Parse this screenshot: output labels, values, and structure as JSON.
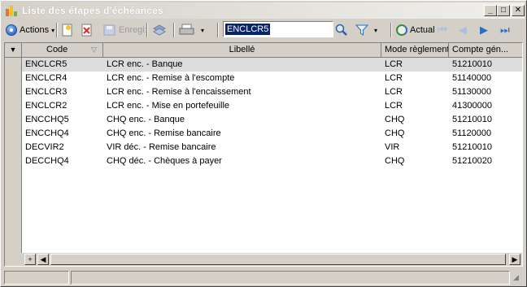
{
  "window": {
    "title": "Liste des étapes d'échéances",
    "min_label": "_",
    "max_label": "□",
    "close_label": "✕"
  },
  "toolbar": {
    "actions_label": "Actions",
    "save_label": "Enregi:",
    "search_value": "ENCLCR5",
    "refresh_label": "Actual"
  },
  "grid": {
    "columns": [
      "Code",
      "Libellé",
      "Mode règlement",
      "Compte gén..."
    ],
    "rows": [
      {
        "code": "ENCLCR5",
        "libelle": "LCR enc. - Banque",
        "mode": "LCR",
        "compte": "51210010"
      },
      {
        "code": "ENCLCR4",
        "libelle": "LCR enc. - Remise à l'escompte",
        "mode": "LCR",
        "compte": "51140000"
      },
      {
        "code": "ENCLCR3",
        "libelle": "LCR enc. - Remise à l'encaissement",
        "mode": "LCR",
        "compte": "51130000"
      },
      {
        "code": "ENCLCR2",
        "libelle": "LCR enc. - Mise en portefeuille",
        "mode": "LCR",
        "compte": "41300000"
      },
      {
        "code": "ENCCHQ5",
        "libelle": "CHQ enc. - Banque",
        "mode": "CHQ",
        "compte": "51210010"
      },
      {
        "code": "ENCCHQ4",
        "libelle": "CHQ enc. - Remise bancaire",
        "mode": "CHQ",
        "compte": "51120000"
      },
      {
        "code": "DECVIR2",
        "libelle": "VIR déc. - Remise bancaire",
        "mode": "VIR",
        "compte": "51210010"
      },
      {
        "code": "DECCHQ4",
        "libelle": "CHQ déc. - Chèques à payer",
        "mode": "CHQ",
        "compte": "51210020"
      }
    ],
    "selected_row": 0
  },
  "icons": [
    "app-icon",
    "actions-icon",
    "new-icon",
    "delete-icon",
    "save-icon",
    "sync-icon",
    "print-icon",
    "search-icon",
    "filter-icon",
    "refresh-icon",
    "first-icon",
    "prev-icon",
    "next-icon",
    "last-icon"
  ]
}
